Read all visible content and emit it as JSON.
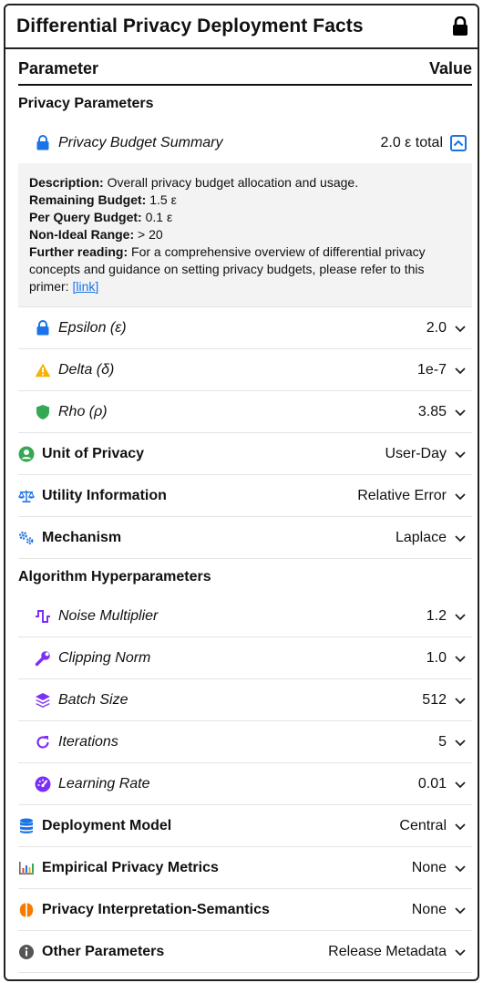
{
  "header": {
    "title": "Differential Privacy Deployment Facts",
    "icon": "lock-icon"
  },
  "columns": {
    "parameter": "Parameter",
    "value": "Value"
  },
  "privacy_parameters": {
    "section_title": "Privacy Parameters",
    "budget_summary": {
      "label": "Privacy Budget Summary",
      "value": "2.0 ε total",
      "expanded": true,
      "details": {
        "description_label": "Description:",
        "description": "Overall privacy budget allocation and usage.",
        "remaining_label": "Remaining Budget:",
        "remaining": "1.5 ε",
        "per_query_label": "Per Query Budget:",
        "per_query": "0.1 ε",
        "non_ideal_label": "Non-Ideal Range:",
        "non_ideal": "> 20",
        "further_label": "Further reading:",
        "further_text": "For a comprehensive overview of differential privacy concepts and guidance on setting privacy budgets, please refer to this primer:",
        "link_text": "[link]"
      }
    },
    "epsilon": {
      "label": "Epsilon (ε)",
      "value": "2.0"
    },
    "delta": {
      "label": "Delta (δ)",
      "value": "1e-7"
    },
    "rho": {
      "label": "Rho (ρ)",
      "value": "3.85"
    }
  },
  "unit_of_privacy": {
    "label": "Unit of Privacy",
    "value": "User-Day"
  },
  "utility_information": {
    "label": "Utility Information",
    "value": "Relative Error"
  },
  "mechanism": {
    "label": "Mechanism",
    "value": "Laplace"
  },
  "algorithm": {
    "section_title": "Algorithm Hyperparameters",
    "noise_multiplier": {
      "label": "Noise Multiplier",
      "value": "1.2"
    },
    "clipping_norm": {
      "label": "Clipping Norm",
      "value": "1.0"
    },
    "batch_size": {
      "label": "Batch Size",
      "value": "512"
    },
    "iterations": {
      "label": "Iterations",
      "value": "5"
    },
    "learning_rate": {
      "label": "Learning Rate",
      "value": "0.01"
    }
  },
  "deployment_model": {
    "label": "Deployment Model",
    "value": "Central"
  },
  "empirical_metrics": {
    "label": "Empirical Privacy Metrics",
    "value": "None"
  },
  "interpretation": {
    "label": "Privacy Interpretation-Semantics",
    "value": "None"
  },
  "other_parameters": {
    "label": "Other Parameters",
    "value": "Release Metadata"
  },
  "colors": {
    "blue": "#1a73e8",
    "warning": "#f4b400",
    "green": "#34a853",
    "purple": "#7b2ff7",
    "orange": "#f57c00",
    "gray": "#555555"
  }
}
